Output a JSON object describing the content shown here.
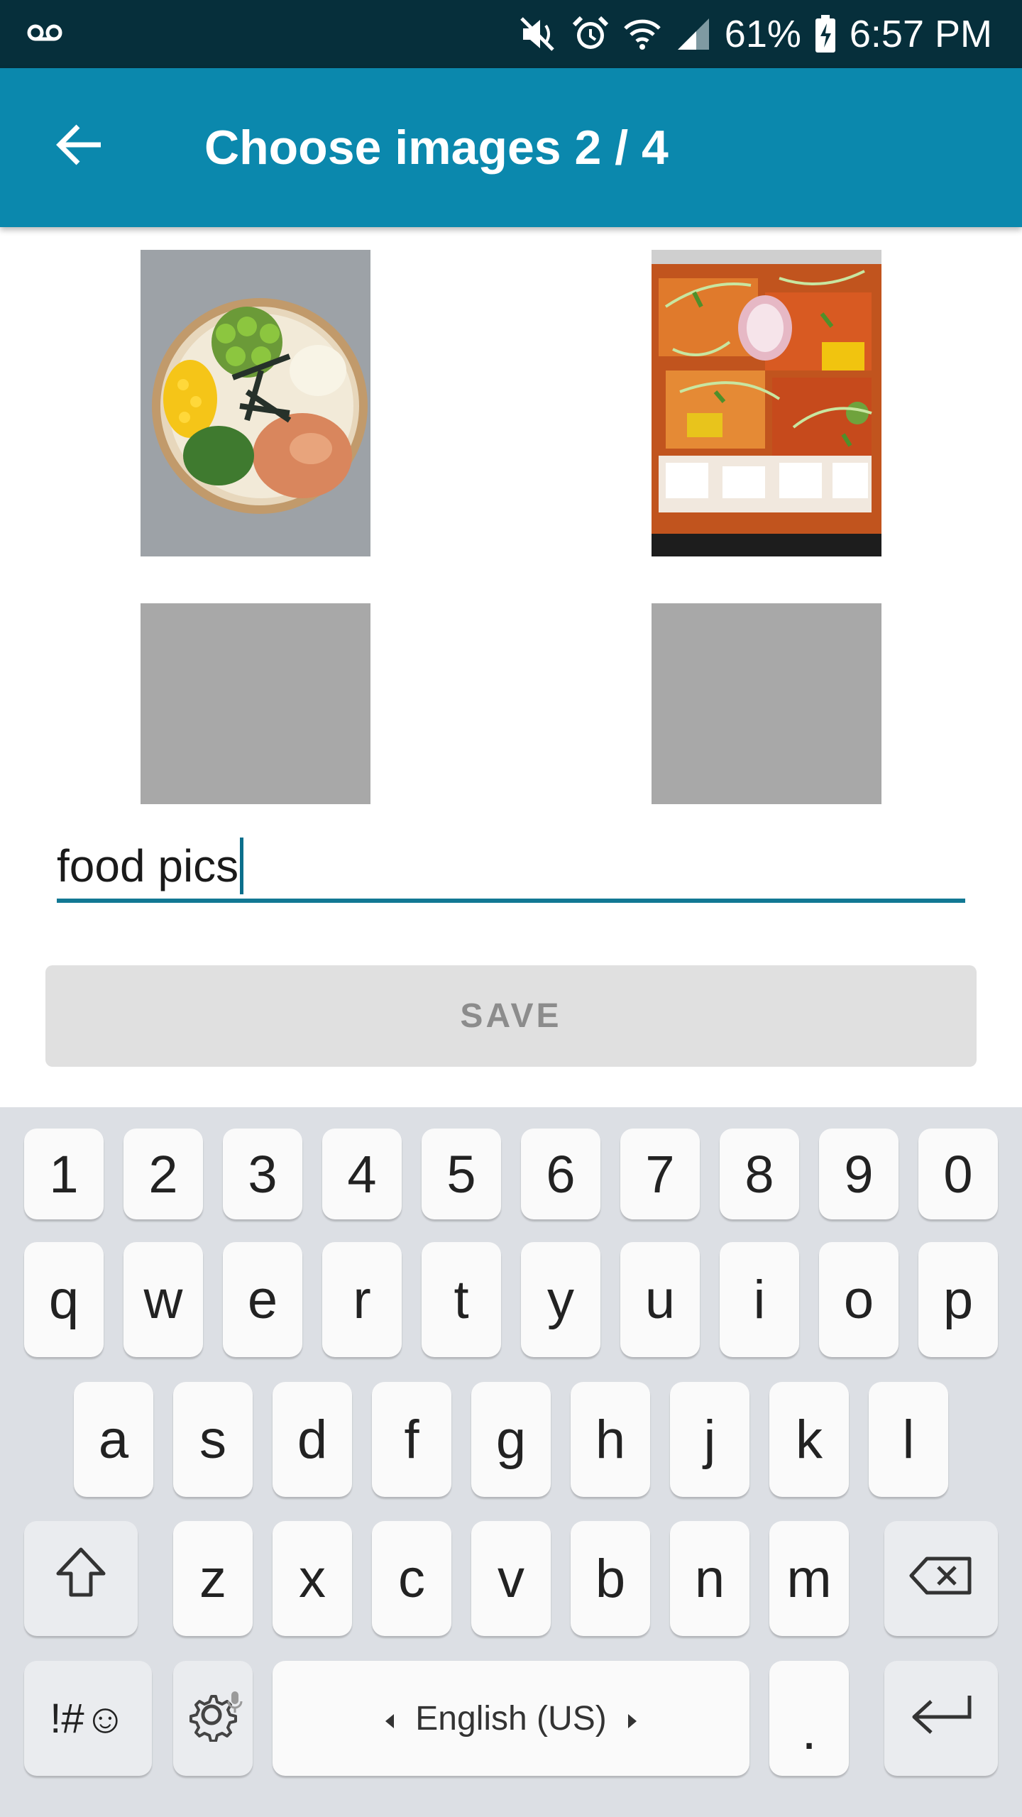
{
  "status_bar": {
    "battery": "61%",
    "time": "6:57 PM",
    "icons": [
      "voicemail-icon",
      "mute-icon",
      "alarm-icon",
      "wifi-icon",
      "signal-icon",
      "battery-charging-icon"
    ]
  },
  "app_bar": {
    "back_icon": "arrow-left-icon",
    "title": "Choose images 2 / 4"
  },
  "images": [
    {
      "name": "image-slot-1",
      "filled": true,
      "content": "poke-bowl-photo"
    },
    {
      "name": "image-slot-2",
      "filled": true,
      "content": "sushi-roll-photo"
    },
    {
      "name": "image-slot-3",
      "filled": false
    },
    {
      "name": "image-slot-4",
      "filled": false
    }
  ],
  "input": {
    "value": "food pics"
  },
  "save_button": {
    "label": "SAVE"
  },
  "keyboard": {
    "row_numbers": [
      "1",
      "2",
      "3",
      "4",
      "5",
      "6",
      "7",
      "8",
      "9",
      "0"
    ],
    "row_top": [
      "q",
      "w",
      "e",
      "r",
      "t",
      "y",
      "u",
      "i",
      "o",
      "p"
    ],
    "row_middle": [
      "a",
      "s",
      "d",
      "f",
      "g",
      "h",
      "j",
      "k",
      "l"
    ],
    "row_bottom": [
      "z",
      "x",
      "c",
      "v",
      "b",
      "n",
      "m"
    ],
    "symbols_label": "!#☺",
    "space_label": "English (US)",
    "period_label": ".",
    "icons": [
      "shift-icon",
      "backspace-icon",
      "settings-icon",
      "microphone-icon",
      "enter-icon"
    ]
  },
  "colors": {
    "status_bar": "#062f3b",
    "app_bar": "#0b88ad",
    "accent": "#127894",
    "keyboard_bg": "#dcdfe4"
  }
}
